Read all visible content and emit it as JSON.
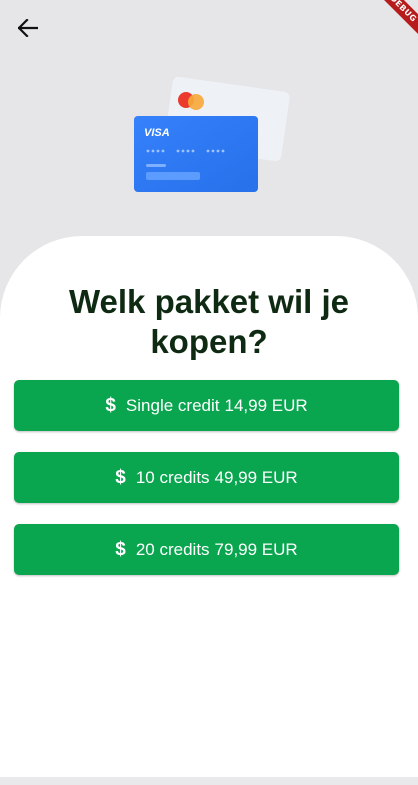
{
  "header": {
    "back_icon": "arrow-left-icon",
    "debug_banner": "DEBUG"
  },
  "illustration": {
    "card_brand": "VISA",
    "card_color": "#2f7cf6",
    "mastercard_colors": [
      "#eb3b2f",
      "#f6a93b"
    ]
  },
  "main": {
    "title": "Welk pakket wil je kopen?",
    "packages": [
      {
        "icon": "dollar-icon",
        "symbol": "$",
        "name": "Single credit",
        "price": "14,99 EUR"
      },
      {
        "icon": "dollar-icon",
        "symbol": "$",
        "name": "10 credits",
        "price": "49,99 EUR"
      },
      {
        "icon": "dollar-icon",
        "symbol": "$",
        "name": "20 credits",
        "price": "79,99 EUR"
      }
    ]
  },
  "colors": {
    "accent": "#0aa54f",
    "title_text": "#0f2a12",
    "background_top": "#e6e6e8"
  }
}
